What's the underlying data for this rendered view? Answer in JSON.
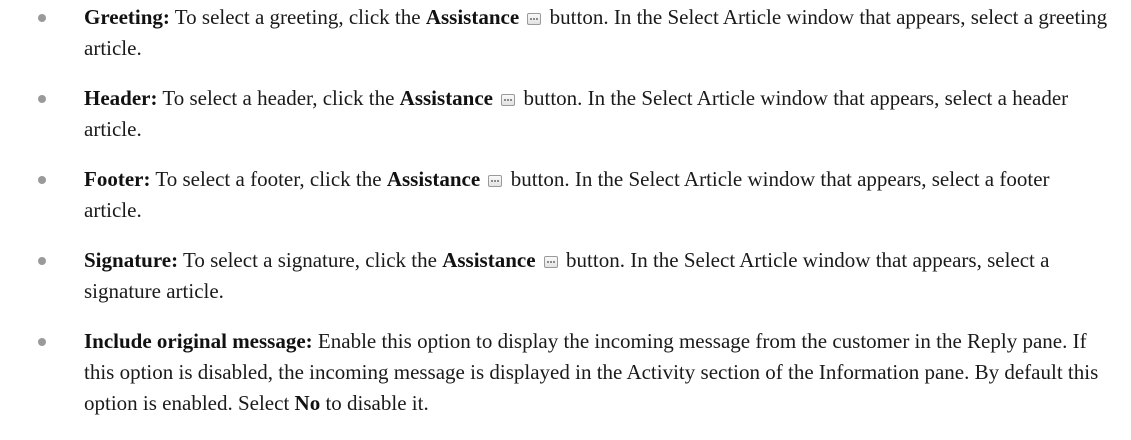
{
  "items": [
    {
      "term": "Greeting:",
      "before": " To select a greeting, click the ",
      "button": "Assistance",
      "after": " button. In the Select Article window that appears, select a greeting article."
    },
    {
      "term": "Header:",
      "before": " To select a header, click the ",
      "button": "Assistance",
      "after": " button. In the Select Article window that appears, select a header article."
    },
    {
      "term": "Footer:",
      "before": " To select a footer, click the ",
      "button": "Assistance",
      "after": " button. In the Select Article window that appears, select a footer article."
    },
    {
      "term": "Signature:",
      "before": " To select a signature, click the ",
      "button": "Assistance",
      "after": " button. In the Select Article window that appears, select a signature article."
    },
    {
      "term": "Include original message:",
      "before": " Enable this option to display the incoming message from the customer in the Reply pane. If this option is disabled, the incoming message is displayed in the Activity section of the Information pane. By default this option is enabled. Select ",
      "button": "No",
      "after": " to disable it."
    }
  ],
  "icons": {
    "assistance": "ellipsis-button-icon"
  }
}
